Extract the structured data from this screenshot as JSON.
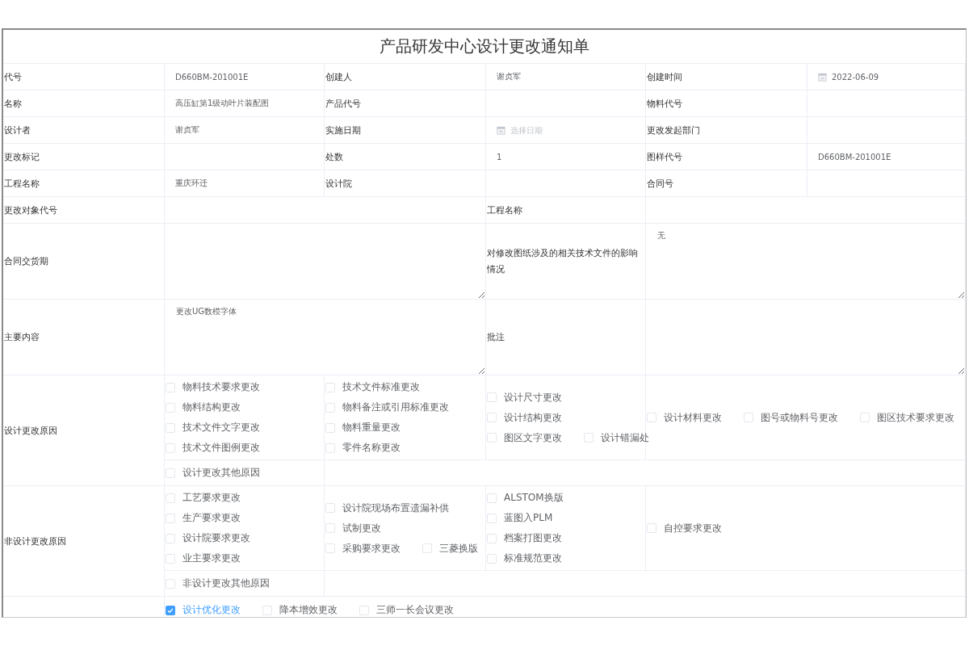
{
  "title": "产品研发中心设计更改通知单",
  "info_rows": [
    [
      {
        "label": "代号",
        "kind": "text",
        "value": "D660BM-201001E"
      },
      {
        "label": "创建人",
        "kind": "text",
        "value": "谢贞军"
      },
      {
        "label": "创建时间",
        "kind": "date",
        "value": "2022-06-09"
      }
    ],
    [
      {
        "label": "名称",
        "kind": "text",
        "value": "高压缸第1级动叶片装配图"
      },
      {
        "label": "产品代号",
        "kind": "text"
      },
      {
        "label": "物料代号",
        "kind": "text"
      }
    ],
    [
      {
        "label": "设计者",
        "kind": "text",
        "value": "谢贞军"
      },
      {
        "label": "实施日期",
        "kind": "date",
        "placeholder": "选择日期"
      },
      {
        "label": "更改发起部门",
        "kind": "text"
      }
    ],
    [
      {
        "label": "更改标记",
        "kind": "text"
      },
      {
        "label": "处数",
        "kind": "text",
        "value": "1"
      },
      {
        "label": "图样代号",
        "kind": "text",
        "value": "D660BM-201001E"
      }
    ],
    [
      {
        "label": "工程名称",
        "kind": "text",
        "value": "重庆环迁"
      },
      {
        "label": "设计院",
        "kind": "text"
      },
      {
        "label": "合同号",
        "kind": "text"
      }
    ]
  ],
  "wide_row": [
    {
      "label": "更改对象代号"
    },
    {
      "label": "工程名称"
    }
  ],
  "text_area_rows": [
    [
      {
        "label": "合同交货期"
      },
      {
        "label": "对修改图纸涉及的相关技术文件的影响情况",
        "value": "无"
      }
    ],
    [
      {
        "label": "主要内容",
        "value": "更改UG数模字体"
      },
      {
        "label": "批注"
      }
    ]
  ],
  "reason_sections": [
    {
      "label": "设计更改原因",
      "groups": [
        [
          [
            {
              "label": "物料技术要求更改",
              "checked": false
            }
          ],
          [
            {
              "label": "物料结构更改",
              "checked": false
            }
          ],
          [
            {
              "label": "技术文件文字更改",
              "checked": false
            }
          ],
          [
            {
              "label": "技术文件图例更改",
              "checked": false
            }
          ]
        ],
        [
          [
            {
              "label": "技术文件标准更改",
              "checked": false
            }
          ],
          [
            {
              "label": "物料备注或引用标准更改",
              "checked": false
            }
          ],
          [
            {
              "label": "物料重量更改",
              "checked": false
            }
          ],
          [
            {
              "label": "零件名称更改",
              "checked": false
            }
          ]
        ],
        [
          [
            {
              "label": "设计尺寸更改",
              "checked": false
            }
          ],
          [
            {
              "label": "设计结构更改",
              "checked": false
            }
          ],
          [
            {
              "label": "图区文字更改",
              "checked": false
            },
            {
              "label": "设计错漏处",
              "checked": false
            }
          ]
        ],
        [
          [
            {
              "label": "设计材料更改",
              "checked": false
            },
            {
              "label": "图号或物料号更改",
              "checked": false
            },
            {
              "label": "图区技术要求更改",
              "checked": false
            }
          ]
        ]
      ],
      "other": {
        "label": "设计更改其他原因",
        "checked": false
      }
    },
    {
      "label": "非设计更改原因",
      "groups": [
        [
          [
            {
              "label": "工艺要求更改",
              "checked": false
            }
          ],
          [
            {
              "label": "生产要求更改",
              "checked": false
            }
          ],
          [
            {
              "label": "设计院要求更改",
              "checked": false
            }
          ],
          [
            {
              "label": "业主要求更改",
              "checked": false
            }
          ]
        ],
        [
          [
            {
              "label": "设计院现场布置遗漏补供",
              "checked": false
            }
          ],
          [
            {
              "label": "试制更改",
              "checked": false
            }
          ],
          [
            {
              "label": "采购要求更改",
              "checked": false
            },
            {
              "label": "三菱换版",
              "checked": false
            }
          ]
        ],
        [
          [
            {
              "label": "ALSTOM换版",
              "checked": false
            }
          ],
          [
            {
              "label": "蓝图入PLM",
              "checked": false
            }
          ],
          [
            {
              "label": "档案打图更改",
              "checked": false
            }
          ],
          [
            {
              "label": "标准规范更改",
              "checked": false
            }
          ]
        ],
        [
          [
            {
              "label": "自控要求更改",
              "checked": false
            }
          ]
        ]
      ],
      "other": {
        "label": "非设计更改其他原因",
        "checked": false
      }
    }
  ],
  "other_reasons": [
    {
      "label": "设计优化更改",
      "checked": true
    },
    {
      "label": "降本增效更改",
      "checked": false
    },
    {
      "label": "三师一长会议更改",
      "checked": false
    }
  ]
}
